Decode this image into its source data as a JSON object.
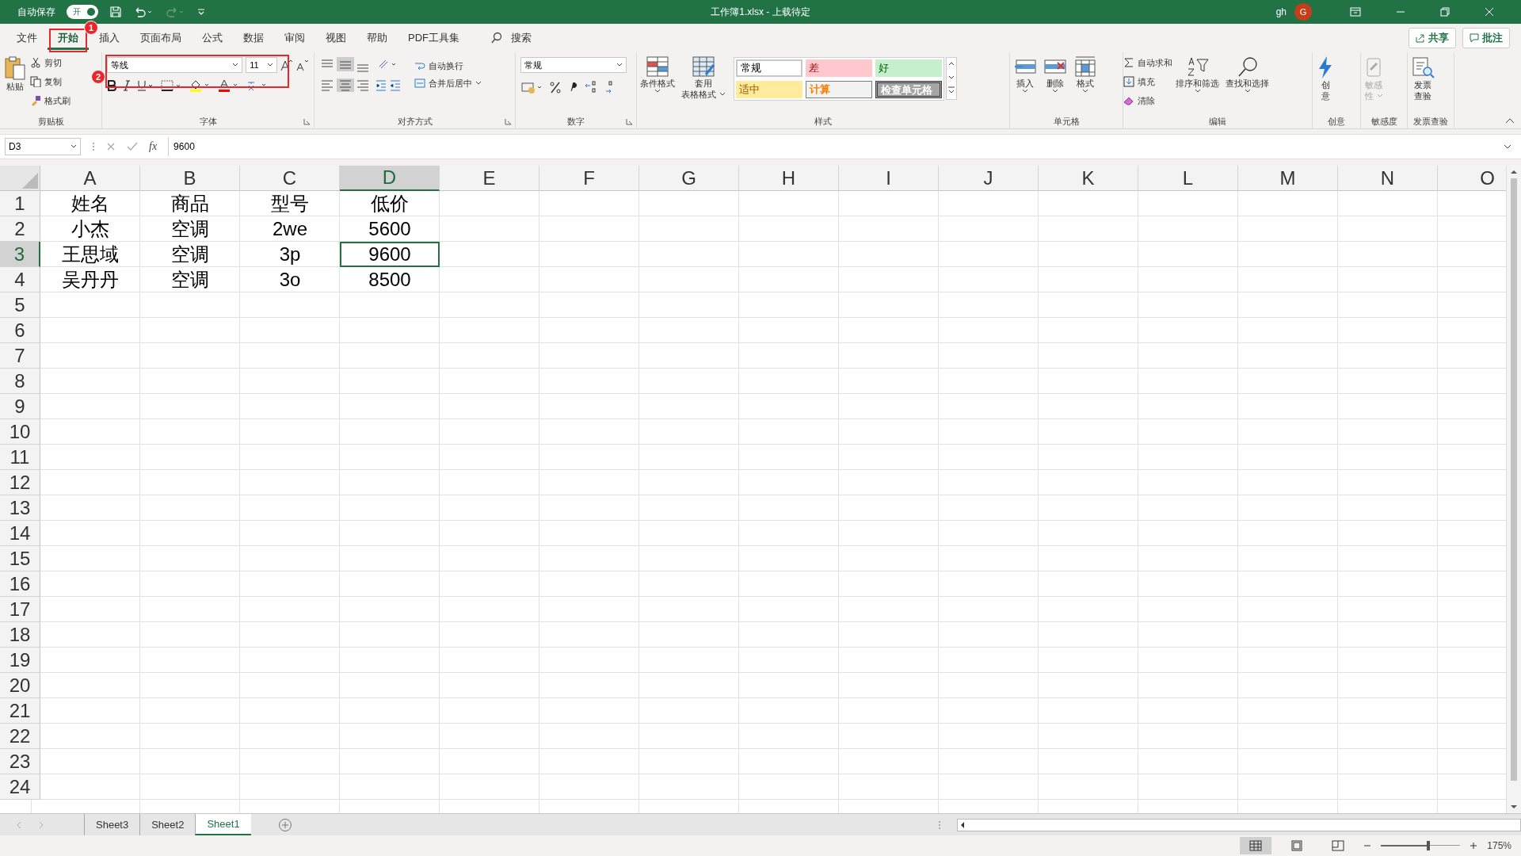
{
  "title_bar": {
    "autosave_label": "自动保存",
    "autosave": {
      "label": "开",
      "on": true
    },
    "document_title": "工作簿1.xlsx - 上载待定",
    "user": "gh",
    "avatar": "G"
  },
  "menu_tabs": [
    {
      "label": "文件",
      "selected": false
    },
    {
      "label": "开始",
      "selected": true,
      "callout": "1"
    },
    {
      "label": "插入",
      "selected": false
    },
    {
      "label": "页面布局",
      "selected": false
    },
    {
      "label": "公式",
      "selected": false
    },
    {
      "label": "数据",
      "selected": false
    },
    {
      "label": "审阅",
      "selected": false
    },
    {
      "label": "视图",
      "selected": false
    },
    {
      "label": "帮助",
      "selected": false
    },
    {
      "label": "PDF工具集",
      "selected": false
    }
  ],
  "search": {
    "label": "搜索"
  },
  "share": "共享",
  "comments": "批注",
  "ribbon": {
    "clipboard": {
      "paste": "粘贴",
      "cut": "剪切",
      "copy": "复制",
      "format_painter": "格式刷",
      "label": "剪贴板"
    },
    "font": {
      "font_name": "等线",
      "font_size": "11",
      "label": "字体",
      "callout": "2"
    },
    "alignment": {
      "wrap": "自动换行",
      "merge": "合并后居中",
      "label": "对齐方式"
    },
    "number": {
      "format": "常规",
      "label": "数字"
    },
    "styles": {
      "conditional": "条件格式",
      "table_top": "套用",
      "table_bottom": "表格格式",
      "label": "样式",
      "cell_styles": [
        {
          "label": "常规",
          "kind": "normal"
        },
        {
          "label": "差",
          "kind": "bad"
        },
        {
          "label": "好",
          "kind": "good"
        },
        {
          "label": "适中",
          "kind": "neutral"
        },
        {
          "label": "计算",
          "kind": "calculation"
        },
        {
          "label": "检查单元格",
          "kind": "check"
        }
      ]
    },
    "cells": {
      "insert": "插入",
      "delete": "删除",
      "format": "格式",
      "label": "单元格"
    },
    "editing": {
      "autosum": "自动求和",
      "fill": "填充",
      "clear": "清除",
      "sort": "排序和筛选",
      "find": "查找和选择",
      "label": "编辑"
    },
    "ideas": {
      "top": "创",
      "bottom": "意",
      "label": "创意"
    },
    "sensitivity": {
      "top": "敏感",
      "bottom": "性",
      "label": "敏感度",
      "disabled": true
    },
    "invoice": {
      "top": "发票",
      "bottom": "查验",
      "label": "发票查验"
    }
  },
  "formula_bar": {
    "name_box": "D3",
    "function_label": "fx",
    "value": "9600"
  },
  "sheet": {
    "columns": [
      {
        "label": "A",
        "selected": false
      },
      {
        "label": "B",
        "selected": false
      },
      {
        "label": "C",
        "selected": false
      },
      {
        "label": "D",
        "selected": true
      },
      {
        "label": "E",
        "selected": false
      },
      {
        "label": "F",
        "selected": false
      },
      {
        "label": "G",
        "selected": false
      },
      {
        "label": "H",
        "selected": false
      },
      {
        "label": "I",
        "selected": false
      },
      {
        "label": "J",
        "selected": false
      },
      {
        "label": "K",
        "selected": false
      },
      {
        "label": "L",
        "selected": false
      },
      {
        "label": "M",
        "selected": false
      },
      {
        "label": "N",
        "selected": false
      },
      {
        "label": "O",
        "selected": false
      }
    ],
    "rows": [
      {
        "header": "1",
        "selected": false,
        "cells": [
          {
            "text": "姓名",
            "selected": false
          },
          {
            "text": "商品",
            "selected": false
          },
          {
            "text": "型号",
            "selected": false
          },
          {
            "text": "低价",
            "selected": false
          }
        ]
      },
      {
        "header": "2",
        "selected": false,
        "cells": [
          {
            "text": "小杰",
            "selected": false
          },
          {
            "text": "空调",
            "selected": false
          },
          {
            "text": "2we",
            "selected": false
          },
          {
            "text": "5600",
            "selected": false
          }
        ]
      },
      {
        "header": "3",
        "selected": true,
        "cells": [
          {
            "text": "王思域",
            "selected": false
          },
          {
            "text": "空调",
            "selected": false
          },
          {
            "text": "3p",
            "selected": false
          },
          {
            "text": "9600",
            "selected": true
          }
        ]
      },
      {
        "header": "4",
        "selected": false,
        "cells": [
          {
            "text": "吴丹丹",
            "selected": false
          },
          {
            "text": "空调",
            "selected": false
          },
          {
            "text": "3o",
            "selected": false
          },
          {
            "text": "8500",
            "selected": false
          }
        ]
      },
      {
        "header": "5",
        "selected": false,
        "cells": []
      },
      {
        "header": "6",
        "selected": false,
        "cells": []
      },
      {
        "header": "7",
        "selected": false,
        "cells": []
      },
      {
        "header": "8",
        "selected": false,
        "cells": []
      },
      {
        "header": "9",
        "selected": false,
        "cells": []
      },
      {
        "header": "10",
        "selected": false,
        "cells": []
      },
      {
        "header": "11",
        "selected": false,
        "cells": []
      },
      {
        "header": "12",
        "selected": false,
        "cells": []
      },
      {
        "header": "13",
        "selected": false,
        "cells": []
      },
      {
        "header": "14",
        "selected": false,
        "cells": []
      },
      {
        "header": "15",
        "selected": false,
        "cells": []
      },
      {
        "header": "16",
        "selected": false,
        "cells": []
      },
      {
        "header": "17",
        "selected": false,
        "cells": []
      },
      {
        "header": "18",
        "selected": false,
        "cells": []
      },
      {
        "header": "19",
        "selected": false,
        "cells": []
      },
      {
        "header": "20",
        "selected": false,
        "cells": []
      },
      {
        "header": "21",
        "selected": false,
        "cells": []
      },
      {
        "header": "22",
        "selected": false,
        "cells": []
      },
      {
        "header": "23",
        "selected": false,
        "cells": []
      },
      {
        "header": "24",
        "selected": false,
        "cells": []
      }
    ]
  },
  "sheet_tabs": [
    {
      "label": "Sheet3",
      "selected": false
    },
    {
      "label": "Sheet2",
      "selected": false
    },
    {
      "label": "Sheet1",
      "selected": true
    }
  ],
  "status_bar": {
    "views": [
      {
        "kind": "normal",
        "selected": true
      },
      {
        "kind": "page_layout",
        "selected": false
      },
      {
        "kind": "page_break",
        "selected": false
      }
    ],
    "zoom": {
      "level": 0.62,
      "label": "175%"
    }
  }
}
